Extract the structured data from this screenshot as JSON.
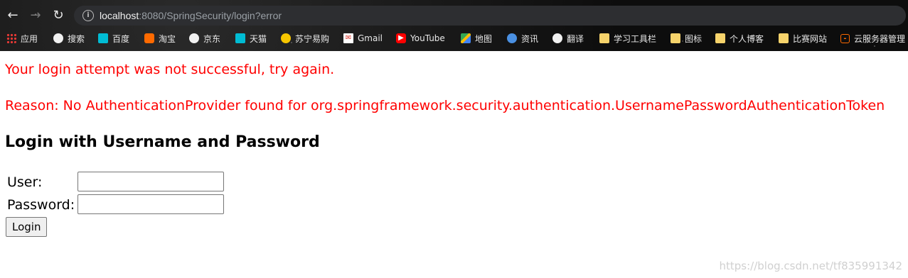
{
  "browser": {
    "url_host": "localhost",
    "url_rest": ":8080/SpringSecurity/login?error",
    "bookmarks": [
      {
        "label": "应用",
        "icon": "apps-icon"
      },
      {
        "label": "搜索",
        "icon": "search-engine-icon"
      },
      {
        "label": "百度",
        "icon": "baidu-icon"
      },
      {
        "label": "淘宝",
        "icon": "taobao-icon"
      },
      {
        "label": "京东",
        "icon": "jd-icon"
      },
      {
        "label": "天猫",
        "icon": "tmall-icon"
      },
      {
        "label": "苏宁易购",
        "icon": "suning-icon"
      },
      {
        "label": "Gmail",
        "icon": "gmail-icon"
      },
      {
        "label": "YouTube",
        "icon": "youtube-icon"
      },
      {
        "label": "地图",
        "icon": "maps-icon"
      },
      {
        "label": "资讯",
        "icon": "news-icon"
      },
      {
        "label": "翻译",
        "icon": "translate-icon"
      },
      {
        "label": "学习工具栏",
        "icon": "folder-icon"
      },
      {
        "label": "图标",
        "icon": "folder-icon"
      },
      {
        "label": "个人博客",
        "icon": "folder-icon"
      },
      {
        "label": "比赛网站",
        "icon": "folder-icon"
      },
      {
        "label": "云服务器管理",
        "icon": "cloud-server-icon"
      }
    ]
  },
  "page": {
    "error_message": "Your login attempt was not successful, try again.",
    "error_reason": "Reason: No AuthenticationProvider found for org.springframework.security.authentication.UsernamePasswordAuthenticationToken",
    "heading": "Login with Username and Password",
    "user_label": "User:",
    "password_label": "Password:",
    "user_value": "",
    "password_value": "",
    "login_button": "Login",
    "watermark": "https://blog.csdn.net/tf835991342"
  },
  "colors": {
    "error": "#ff0000",
    "chrome_bg": "#0b0b0b",
    "omnibox_bg": "#2d2e31"
  }
}
